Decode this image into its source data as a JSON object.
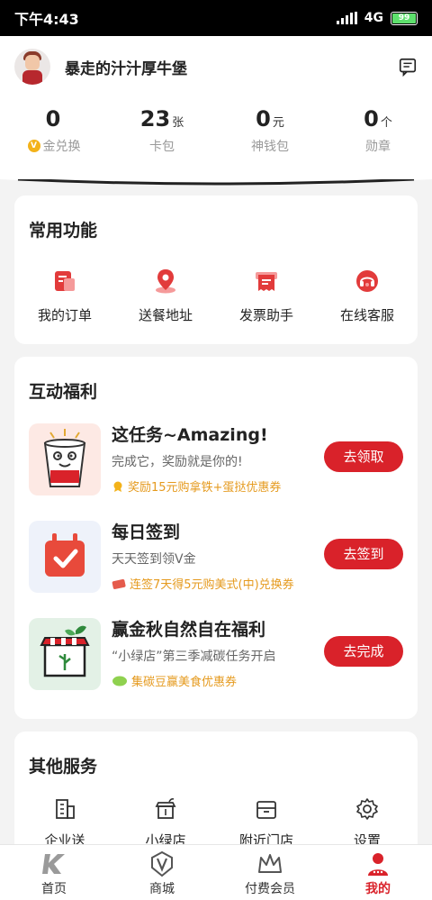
{
  "status_bar": {
    "time": "下午4:43",
    "network": "4G",
    "battery": "99"
  },
  "profile": {
    "username": "暴走的汁汁厚牛堡"
  },
  "stats": [
    {
      "value": "0",
      "unit": "",
      "label": "金兑换",
      "badge": "V"
    },
    {
      "value": "23",
      "unit": "张",
      "label": "卡包"
    },
    {
      "value": "0",
      "unit": "元",
      "label": "神钱包"
    },
    {
      "value": "0",
      "unit": "个",
      "label": "勋章"
    }
  ],
  "common_functions": {
    "title": "常用功能",
    "items": [
      {
        "label": "我的订单",
        "icon": "order-icon"
      },
      {
        "label": "送餐地址",
        "icon": "location-pin-icon"
      },
      {
        "label": "发票助手",
        "icon": "invoice-icon"
      },
      {
        "label": "在线客服",
        "icon": "headset-icon"
      }
    ]
  },
  "benefits": {
    "title": "互动福利",
    "tasks": [
      {
        "title": "这任务~Amazing!",
        "subtitle": "完成它，奖励就是你的!",
        "reward": "奖励15元购拿铁+蛋挞优惠券",
        "button": "去领取"
      },
      {
        "title": "每日签到",
        "subtitle": "天天签到领V金",
        "reward": "连签7天得5元购美式(中)兑换券",
        "button": "去签到"
      },
      {
        "title": "赢金秋自然自在福利",
        "subtitle": "“小绿店”第三季减碳任务开启",
        "reward": "集碳豆赢美食优惠券",
        "button": "去完成"
      }
    ]
  },
  "other_services": {
    "title": "其他服务",
    "items": [
      {
        "label": "企业送",
        "icon": "building-icon"
      },
      {
        "label": "小绿店",
        "icon": "green-store-icon"
      },
      {
        "label": "附近门店",
        "icon": "store-box-icon"
      },
      {
        "label": "设置",
        "icon": "gear-icon"
      }
    ]
  },
  "tabbar": {
    "items": [
      {
        "label": "首页",
        "icon": "home-k-logo-icon"
      },
      {
        "label": "商城",
        "icon": "v-shield-icon"
      },
      {
        "label": "付费会员",
        "icon": "crown-icon"
      },
      {
        "label": "我的",
        "icon": "person-icon",
        "active": true
      }
    ]
  },
  "colors": {
    "accent": "#d9222a",
    "reward": "#e59a1e",
    "coin": "#f3b21a"
  }
}
